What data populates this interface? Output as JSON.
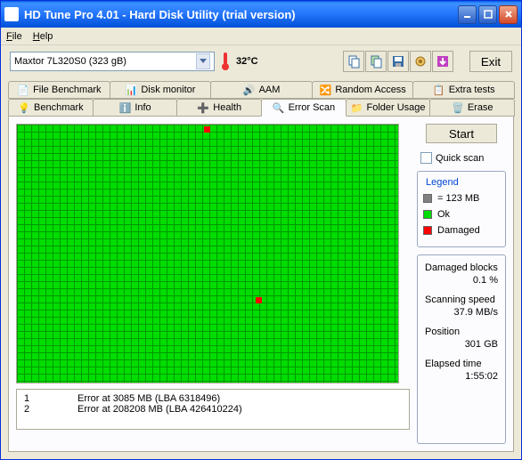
{
  "title": "HD Tune Pro 4.01 - Hard Disk Utility (trial version)",
  "menu": {
    "file": "File",
    "help": "Help"
  },
  "drive": "Maxtor 7L320S0 (323 gB)",
  "temp": "32°C",
  "exit": "Exit",
  "tabs_top": [
    "File Benchmark",
    "Disk monitor",
    "AAM",
    "Random Access",
    "Extra tests"
  ],
  "tabs_bottom": [
    "Benchmark",
    "Info",
    "Health",
    "Error Scan",
    "Folder Usage",
    "Erase"
  ],
  "start": "Start",
  "quickscan": "Quick scan",
  "legend": {
    "title": "Legend",
    "block": "= 123 MB",
    "ok": "Ok",
    "damaged": "Damaged"
  },
  "stats": {
    "damaged_label": "Damaged blocks",
    "damaged_value": "0.1 %",
    "speed_label": "Scanning speed",
    "speed_value": "37.9 MB/s",
    "position_label": "Position",
    "position_value": "301 GB",
    "elapsed_label": "Elapsed time",
    "elapsed_value": "1:55:02"
  },
  "errors": [
    {
      "n": "1",
      "msg": "Error at 3085 MB (LBA 6318496)"
    },
    {
      "n": "2",
      "msg": "Error at 208208 MB (LBA 426410224)"
    }
  ]
}
